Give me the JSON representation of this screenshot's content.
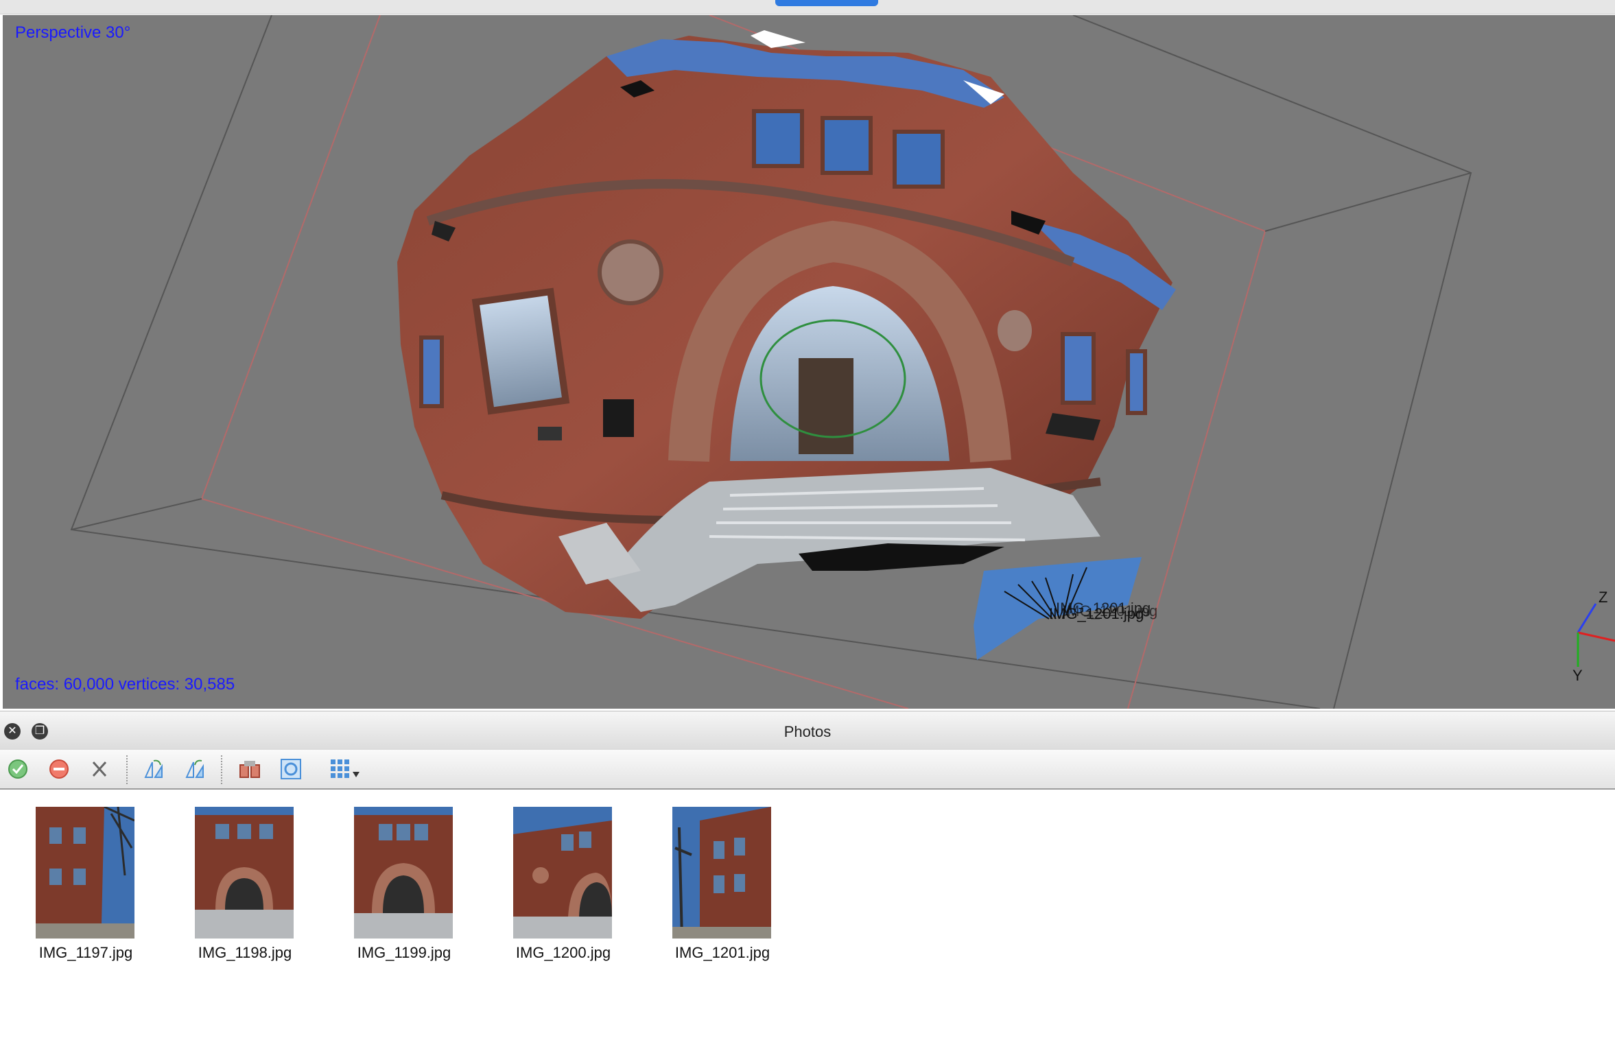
{
  "viewport": {
    "projection_label": "Perspective 30°",
    "stats_label": "faces: 60,000 vertices: 30,585",
    "camera_labels_text": "IMG_1201.jpg",
    "axis_labels": {
      "z": "Z",
      "y": "Y"
    }
  },
  "photos_panel": {
    "title": "Photos",
    "toolbar": [
      {
        "name": "enable-cameras-icon",
        "color": "#4caf50"
      },
      {
        "name": "disable-cameras-icon",
        "color": "#e53935"
      },
      {
        "name": "remove-cameras-icon",
        "color": "#666666"
      },
      {
        "name": "rotate-left-icon",
        "color": "#4a90d9"
      },
      {
        "name": "rotate-right-icon",
        "color": "#4a90d9"
      },
      {
        "name": "filter-icon",
        "color": "#c0392b"
      },
      {
        "name": "reset-view-icon",
        "color": "#4a90d9"
      },
      {
        "name": "view-mode-icon",
        "color": "#4a90d9"
      }
    ],
    "photos": [
      {
        "label": "IMG_1197.jpg"
      },
      {
        "label": "IMG_1198.jpg"
      },
      {
        "label": "IMG_1199.jpg"
      },
      {
        "label": "IMG_1200.jpg"
      },
      {
        "label": "IMG_1201.jpg"
      }
    ]
  }
}
